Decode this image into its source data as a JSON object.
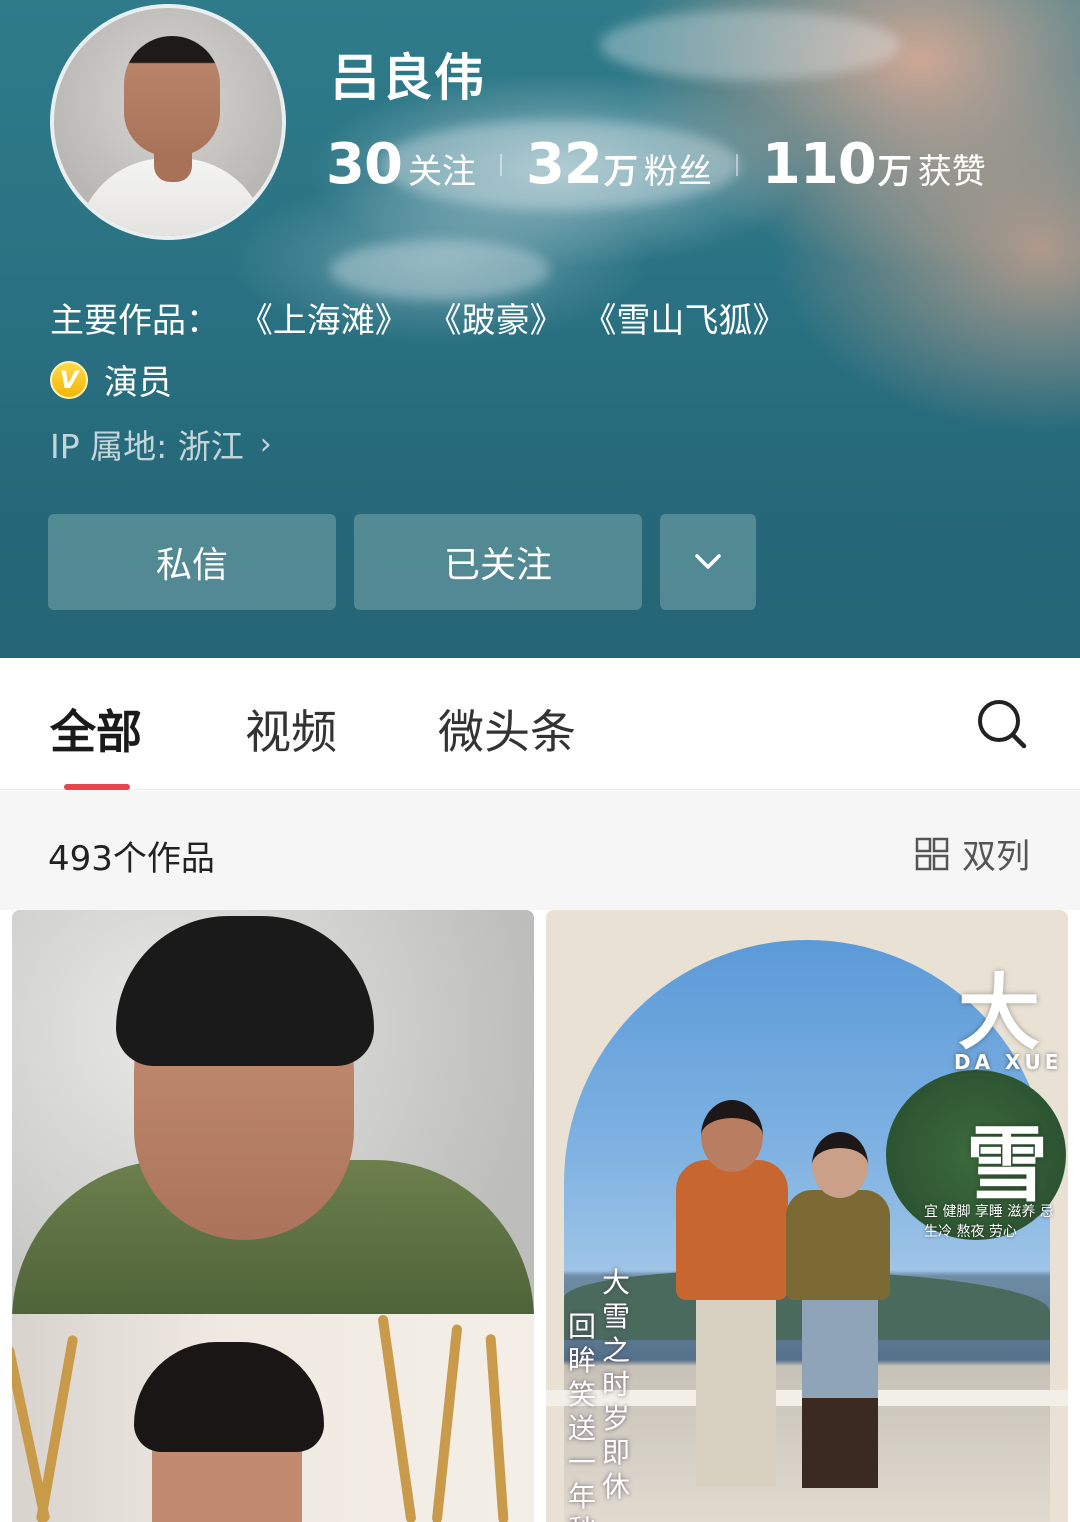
{
  "profile": {
    "name": "吕良伟",
    "stats": [
      {
        "num": "30",
        "unit": "",
        "label": "关注"
      },
      {
        "num": "32",
        "unit": "万",
        "label": "粉丝"
      },
      {
        "num": "110",
        "unit": "万",
        "label": "获赞"
      }
    ],
    "works_label": "主要作品：",
    "works": [
      "《上海滩》",
      "《跛豪》",
      "《雪山飞狐》"
    ],
    "verify_badge": "V",
    "verify_text": "演员",
    "ip": "IP 属地: 浙江",
    "ip_chevron": "›"
  },
  "actions": {
    "message": "私信",
    "follow": "已关注",
    "more_icon": "chevron-down-icon"
  },
  "tabs": {
    "items": [
      "全部",
      "视频",
      "微头条"
    ],
    "active": "全部"
  },
  "list": {
    "count": "493个作品",
    "layout_toggle": "双列"
  },
  "cards": {
    "right_title_1": "大",
    "right_title_2": "雪",
    "right_daxue": "DA XUE",
    "right_small": "宜 健脚 享睡 滋养 忌 生冷 熬夜 劳心",
    "right_poem_1": "大雪之时岁即休",
    "right_poem_2": "回眸笑送一年愁"
  },
  "colors": {
    "header_bg": "#2a7384",
    "tab_indicator": "#e8454f",
    "verify_gold": "#f2b705"
  }
}
